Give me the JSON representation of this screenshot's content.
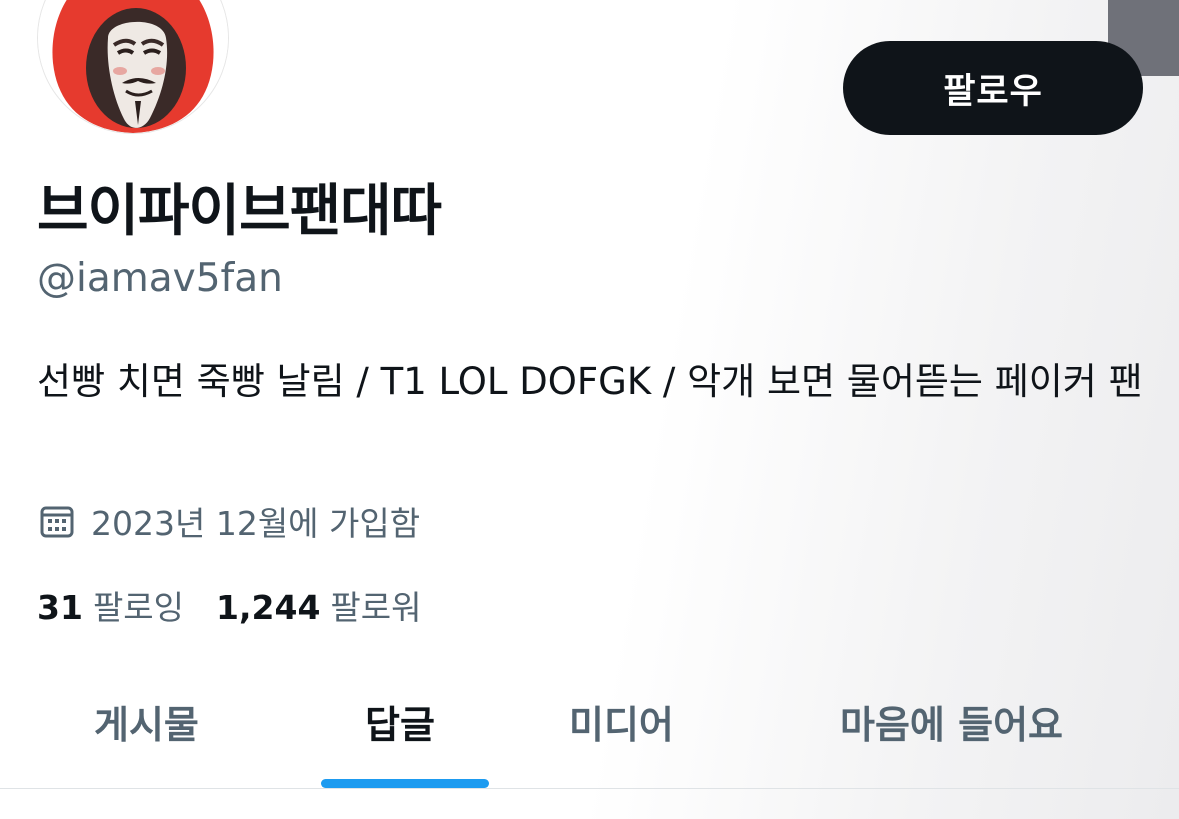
{
  "profile": {
    "display_name": "브이파이브팬대따",
    "handle": "@iamav5fan",
    "bio": "선빵 치면 죽빵 날림 / T1 LOL DOFGK / 악개 보면 물어뜯는 페이커 팬",
    "joined": "2023년 12월에 가입함",
    "avatar_icon": "mask-avatar-icon"
  },
  "actions": {
    "follow_label": "팔로우"
  },
  "stats": {
    "following_count": "31",
    "following_label": "팔로잉",
    "followers_count": "1,244",
    "followers_label": "팔로워"
  },
  "tabs": [
    {
      "label": "게시물",
      "active": false
    },
    {
      "label": "답글",
      "active": true
    },
    {
      "label": "미디어",
      "active": false
    },
    {
      "label": "마음에 들어요",
      "active": false
    }
  ],
  "colors": {
    "accent": "#1d9bf0",
    "text_primary": "#0f1419",
    "text_secondary": "#536471",
    "button_bg": "#0f1419"
  }
}
